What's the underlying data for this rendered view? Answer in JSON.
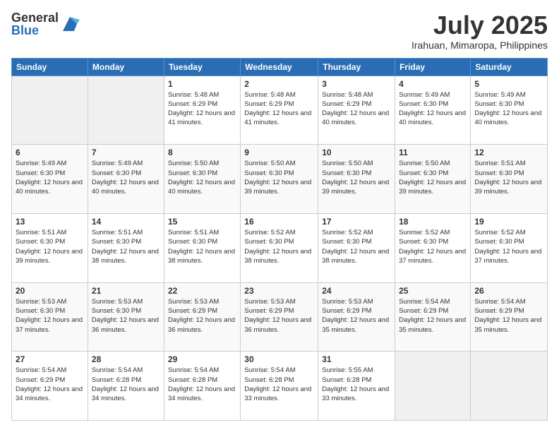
{
  "header": {
    "logo_general": "General",
    "logo_blue": "Blue",
    "month_title": "July 2025",
    "location": "Irahuan, Mimaropa, Philippines"
  },
  "weekdays": [
    "Sunday",
    "Monday",
    "Tuesday",
    "Wednesday",
    "Thursday",
    "Friday",
    "Saturday"
  ],
  "weeks": [
    [
      {
        "day": "",
        "sunrise": "",
        "sunset": "",
        "daylight": "",
        "empty": true
      },
      {
        "day": "",
        "sunrise": "",
        "sunset": "",
        "daylight": "",
        "empty": true
      },
      {
        "day": "1",
        "sunrise": "Sunrise: 5:48 AM",
        "sunset": "Sunset: 6:29 PM",
        "daylight": "Daylight: 12 hours and 41 minutes.",
        "empty": false
      },
      {
        "day": "2",
        "sunrise": "Sunrise: 5:48 AM",
        "sunset": "Sunset: 6:29 PM",
        "daylight": "Daylight: 12 hours and 41 minutes.",
        "empty": false
      },
      {
        "day": "3",
        "sunrise": "Sunrise: 5:48 AM",
        "sunset": "Sunset: 6:29 PM",
        "daylight": "Daylight: 12 hours and 40 minutes.",
        "empty": false
      },
      {
        "day": "4",
        "sunrise": "Sunrise: 5:49 AM",
        "sunset": "Sunset: 6:30 PM",
        "daylight": "Daylight: 12 hours and 40 minutes.",
        "empty": false
      },
      {
        "day": "5",
        "sunrise": "Sunrise: 5:49 AM",
        "sunset": "Sunset: 6:30 PM",
        "daylight": "Daylight: 12 hours and 40 minutes.",
        "empty": false
      }
    ],
    [
      {
        "day": "6",
        "sunrise": "Sunrise: 5:49 AM",
        "sunset": "Sunset: 6:30 PM",
        "daylight": "Daylight: 12 hours and 40 minutes.",
        "empty": false
      },
      {
        "day": "7",
        "sunrise": "Sunrise: 5:49 AM",
        "sunset": "Sunset: 6:30 PM",
        "daylight": "Daylight: 12 hours and 40 minutes.",
        "empty": false
      },
      {
        "day": "8",
        "sunrise": "Sunrise: 5:50 AM",
        "sunset": "Sunset: 6:30 PM",
        "daylight": "Daylight: 12 hours and 40 minutes.",
        "empty": false
      },
      {
        "day": "9",
        "sunrise": "Sunrise: 5:50 AM",
        "sunset": "Sunset: 6:30 PM",
        "daylight": "Daylight: 12 hours and 39 minutes.",
        "empty": false
      },
      {
        "day": "10",
        "sunrise": "Sunrise: 5:50 AM",
        "sunset": "Sunset: 6:30 PM",
        "daylight": "Daylight: 12 hours and 39 minutes.",
        "empty": false
      },
      {
        "day": "11",
        "sunrise": "Sunrise: 5:50 AM",
        "sunset": "Sunset: 6:30 PM",
        "daylight": "Daylight: 12 hours and 39 minutes.",
        "empty": false
      },
      {
        "day": "12",
        "sunrise": "Sunrise: 5:51 AM",
        "sunset": "Sunset: 6:30 PM",
        "daylight": "Daylight: 12 hours and 39 minutes.",
        "empty": false
      }
    ],
    [
      {
        "day": "13",
        "sunrise": "Sunrise: 5:51 AM",
        "sunset": "Sunset: 6:30 PM",
        "daylight": "Daylight: 12 hours and 39 minutes.",
        "empty": false
      },
      {
        "day": "14",
        "sunrise": "Sunrise: 5:51 AM",
        "sunset": "Sunset: 6:30 PM",
        "daylight": "Daylight: 12 hours and 38 minutes.",
        "empty": false
      },
      {
        "day": "15",
        "sunrise": "Sunrise: 5:51 AM",
        "sunset": "Sunset: 6:30 PM",
        "daylight": "Daylight: 12 hours and 38 minutes.",
        "empty": false
      },
      {
        "day": "16",
        "sunrise": "Sunrise: 5:52 AM",
        "sunset": "Sunset: 6:30 PM",
        "daylight": "Daylight: 12 hours and 38 minutes.",
        "empty": false
      },
      {
        "day": "17",
        "sunrise": "Sunrise: 5:52 AM",
        "sunset": "Sunset: 6:30 PM",
        "daylight": "Daylight: 12 hours and 38 minutes.",
        "empty": false
      },
      {
        "day": "18",
        "sunrise": "Sunrise: 5:52 AM",
        "sunset": "Sunset: 6:30 PM",
        "daylight": "Daylight: 12 hours and 37 minutes.",
        "empty": false
      },
      {
        "day": "19",
        "sunrise": "Sunrise: 5:52 AM",
        "sunset": "Sunset: 6:30 PM",
        "daylight": "Daylight: 12 hours and 37 minutes.",
        "empty": false
      }
    ],
    [
      {
        "day": "20",
        "sunrise": "Sunrise: 5:53 AM",
        "sunset": "Sunset: 6:30 PM",
        "daylight": "Daylight: 12 hours and 37 minutes.",
        "empty": false
      },
      {
        "day": "21",
        "sunrise": "Sunrise: 5:53 AM",
        "sunset": "Sunset: 6:30 PM",
        "daylight": "Daylight: 12 hours and 36 minutes.",
        "empty": false
      },
      {
        "day": "22",
        "sunrise": "Sunrise: 5:53 AM",
        "sunset": "Sunset: 6:29 PM",
        "daylight": "Daylight: 12 hours and 36 minutes.",
        "empty": false
      },
      {
        "day": "23",
        "sunrise": "Sunrise: 5:53 AM",
        "sunset": "Sunset: 6:29 PM",
        "daylight": "Daylight: 12 hours and 36 minutes.",
        "empty": false
      },
      {
        "day": "24",
        "sunrise": "Sunrise: 5:53 AM",
        "sunset": "Sunset: 6:29 PM",
        "daylight": "Daylight: 12 hours and 35 minutes.",
        "empty": false
      },
      {
        "day": "25",
        "sunrise": "Sunrise: 5:54 AM",
        "sunset": "Sunset: 6:29 PM",
        "daylight": "Daylight: 12 hours and 35 minutes.",
        "empty": false
      },
      {
        "day": "26",
        "sunrise": "Sunrise: 5:54 AM",
        "sunset": "Sunset: 6:29 PM",
        "daylight": "Daylight: 12 hours and 35 minutes.",
        "empty": false
      }
    ],
    [
      {
        "day": "27",
        "sunrise": "Sunrise: 5:54 AM",
        "sunset": "Sunset: 6:29 PM",
        "daylight": "Daylight: 12 hours and 34 minutes.",
        "empty": false
      },
      {
        "day": "28",
        "sunrise": "Sunrise: 5:54 AM",
        "sunset": "Sunset: 6:28 PM",
        "daylight": "Daylight: 12 hours and 34 minutes.",
        "empty": false
      },
      {
        "day": "29",
        "sunrise": "Sunrise: 5:54 AM",
        "sunset": "Sunset: 6:28 PM",
        "daylight": "Daylight: 12 hours and 34 minutes.",
        "empty": false
      },
      {
        "day": "30",
        "sunrise": "Sunrise: 5:54 AM",
        "sunset": "Sunset: 6:28 PM",
        "daylight": "Daylight: 12 hours and 33 minutes.",
        "empty": false
      },
      {
        "day": "31",
        "sunrise": "Sunrise: 5:55 AM",
        "sunset": "Sunset: 6:28 PM",
        "daylight": "Daylight: 12 hours and 33 minutes.",
        "empty": false
      },
      {
        "day": "",
        "sunrise": "",
        "sunset": "",
        "daylight": "",
        "empty": true
      },
      {
        "day": "",
        "sunrise": "",
        "sunset": "",
        "daylight": "",
        "empty": true
      }
    ]
  ]
}
